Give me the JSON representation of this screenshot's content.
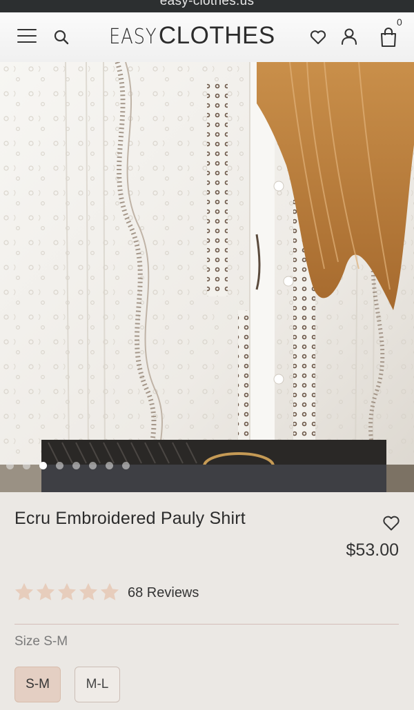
{
  "browser": {
    "url": "easy-clothes.us"
  },
  "header": {
    "logo_light": "EASY",
    "logo_bold": "CLOTHES",
    "cart_count": "0",
    "icons": [
      "menu-icon",
      "search-icon",
      "heart-icon",
      "user-icon",
      "bag-icon"
    ]
  },
  "gallery": {
    "slide_count": 8,
    "active_index": 2
  },
  "product": {
    "title": "Ecru Embroidered Pauly Shirt",
    "price": "$53.00",
    "rating": 5,
    "reviews": "68 Reviews",
    "size_label": "Size S-M",
    "sizes": [
      "S-M",
      "M-L"
    ],
    "selected_size": "S-M"
  },
  "colors": {
    "star": "#e7cdbc",
    "selected_size_bg": "#e4cfc3",
    "divider": "#d3bdb8"
  }
}
